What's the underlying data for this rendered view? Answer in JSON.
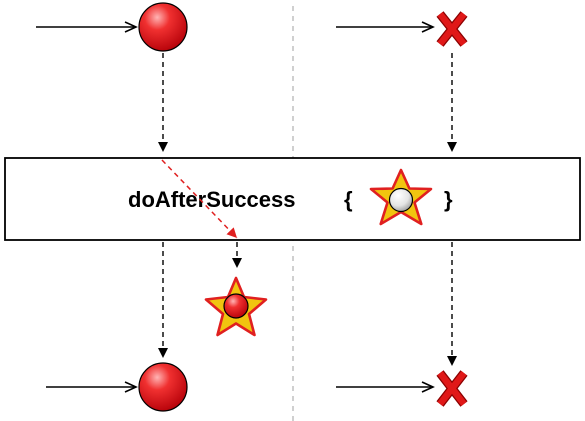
{
  "operator": {
    "name": "doAfterSuccess",
    "open_brace": "{",
    "close_brace": "}"
  },
  "diagram": {
    "type": "marble-diagram",
    "sources": [
      {
        "id": "success-stream",
        "upstream_item": "red-ball",
        "downstream_item": "red-ball"
      },
      {
        "id": "error-stream",
        "upstream_item": "error-x",
        "downstream_item": "error-x"
      }
    ],
    "side_effect_item": "ball-in-star",
    "error_glyph": "X"
  },
  "colors": {
    "ball": "#e8141c",
    "ball_highlight": "#ffb0b0",
    "error": "#e01818",
    "star_fill": "#f1c40f",
    "star_stroke": "#e02020",
    "inner_ball": "#f4f4f4",
    "side_effect_arrow": "#e02020",
    "divider": "#b0b0b0"
  },
  "icons": {
    "upstream_success": "red-ball-icon",
    "upstream_error": "error-x-icon",
    "operator_symbol": "star-with-ball-icon",
    "side_effect": "star-with-red-ball-icon",
    "downstream_success": "red-ball-icon",
    "downstream_error": "error-x-icon"
  }
}
